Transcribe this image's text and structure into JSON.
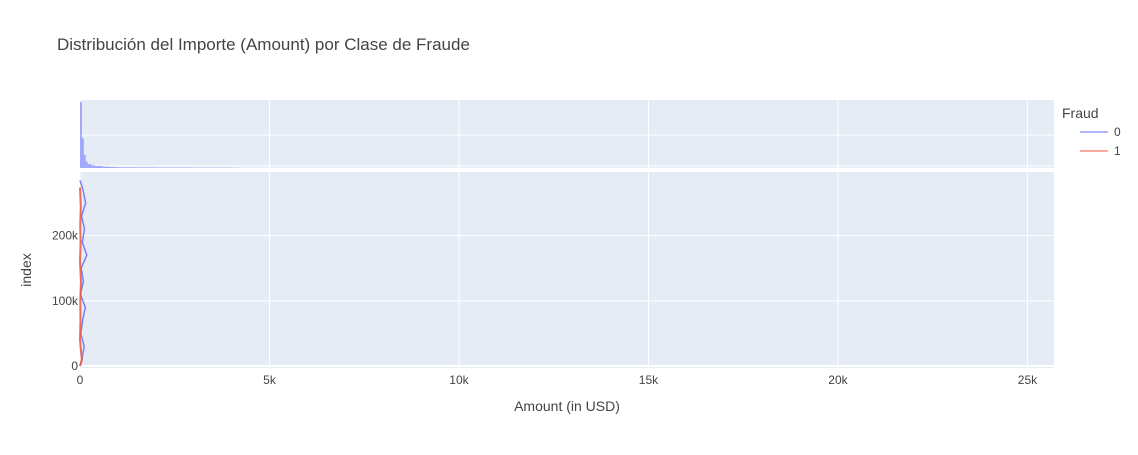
{
  "chart_data": {
    "type": "line",
    "title": "Distribución del Importe (Amount) por Clase de Fraude",
    "xlabel": "Amount (in USD)",
    "ylabel": "index",
    "xlim": [
      0,
      25700
    ],
    "ylim": [
      0,
      290000
    ],
    "x_ticks": [
      {
        "value": 0,
        "label": "0"
      },
      {
        "value": 5000,
        "label": "5k"
      },
      {
        "value": 10000,
        "label": "10k"
      },
      {
        "value": 15000,
        "label": "15k"
      },
      {
        "value": 20000,
        "label": "20k"
      },
      {
        "value": 25000,
        "label": "25k"
      }
    ],
    "y_ticks": [
      {
        "value": 0,
        "label": "0"
      },
      {
        "value": 100000,
        "label": "100k"
      },
      {
        "value": 200000,
        "label": "200k"
      }
    ],
    "legend": {
      "title": "Fraud",
      "placement": "right",
      "entries": [
        {
          "name": "0",
          "color": "#636efa"
        },
        {
          "name": "1",
          "color": "#ef553b"
        }
      ]
    },
    "grid": true,
    "background_color": "#e5ecf6",
    "marginal": {
      "type": "histogram",
      "note_values_are_relative_frequency": true,
      "bins_x": [
        0,
        50,
        100,
        150,
        200,
        300,
        400,
        600,
        800,
        1000,
        1500,
        2000,
        3000,
        4000
      ],
      "heights": [
        1.0,
        0.45,
        0.2,
        0.1,
        0.06,
        0.04,
        0.03,
        0.02,
        0.015,
        0.01,
        0.008,
        0.006,
        0.004,
        0.002
      ]
    },
    "series": [
      {
        "name": "0",
        "color": "#636efa",
        "x": [
          0,
          80,
          150,
          40,
          120,
          60,
          180,
          30,
          90,
          10,
          140,
          70,
          20,
          110,
          50,
          0
        ],
        "y": [
          284807,
          270000,
          250000,
          230000,
          210000,
          190000,
          170000,
          150000,
          130000,
          110000,
          90000,
          70000,
          50000,
          30000,
          10000,
          0
        ]
      },
      {
        "name": "1",
        "color": "#ef553b",
        "x": [
          0,
          20,
          5,
          15,
          0,
          25,
          8,
          12,
          0,
          30,
          50,
          0
        ],
        "y": [
          274000,
          245000,
          215000,
          190000,
          160000,
          130000,
          100000,
          70000,
          40000,
          20000,
          10000,
          0
        ]
      }
    ]
  }
}
